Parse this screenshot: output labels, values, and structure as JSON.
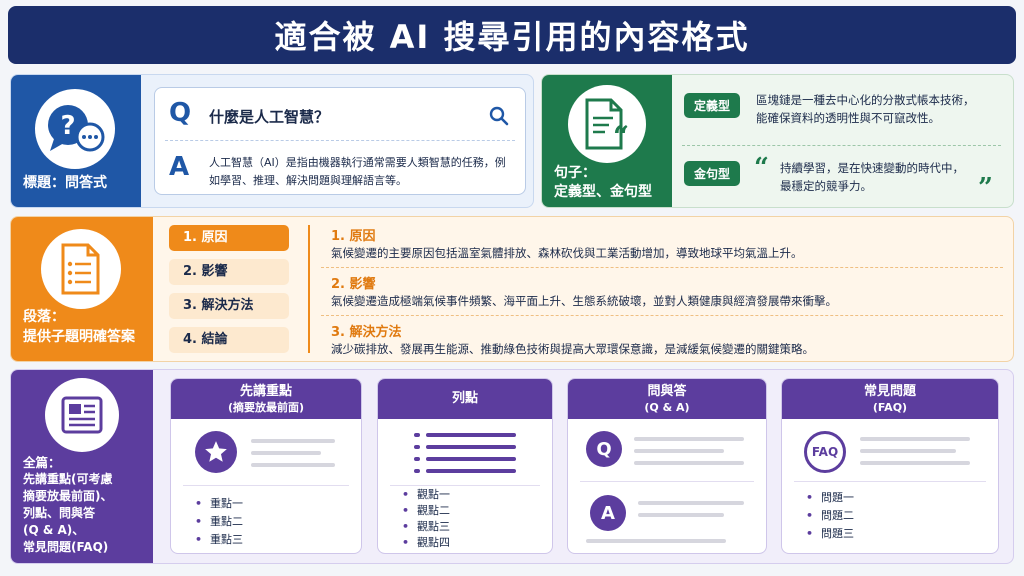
{
  "title": "適合被 AI 搜尋引用的內容格式",
  "qa_panel": {
    "label": "標題：問答式",
    "q_letter": "Q",
    "question": "什麼是人工智慧？",
    "a_letter": "A",
    "answer": "人工智慧（AI）是指由機器執行通常需要人類智慧的任務，例如學習、推理、解決問題與理解語言等。",
    "icon": "question-chat-icon"
  },
  "sentence_panel": {
    "label_line1": "句子：",
    "label_line2": "定義型、金句型",
    "definition_tag": "定義型",
    "definition_line1": "區塊鏈是一種去中心化的分散式帳本技術，",
    "definition_line2": "能確保資料的透明性與不可竄改性。",
    "quote_tag": "金句型",
    "quote_line1": "持續學習，是在快速變動的時代中，",
    "quote_line2": "最穩定的競爭力。",
    "icon": "document-quote-icon"
  },
  "paragraph_panel": {
    "label_line1": "段落：",
    "label_line2": "提供子題明確答案",
    "nav": [
      "1. 原因",
      "2. 影響",
      "3. 解決方法",
      "4. 結論"
    ],
    "sections": [
      {
        "heading": "1. 原因",
        "body": "氣候變遷的主要原因包括溫室氣體排放、森林砍伐與工業活動增加，導致地球平均氣溫上升。"
      },
      {
        "heading": "2. 影響",
        "body": "氣候變遷造成極端氣候事件頻繁、海平面上升、生態系統破壞，並對人類健康與經濟發展帶來衝擊。"
      },
      {
        "heading": "3. 解決方法",
        "body": "減少碳排放、發展再生能源、推動綠色技術與提高大眾環保意識，是減緩氣候變遷的關鍵策略。"
      }
    ],
    "icon": "list-document-icon"
  },
  "article_panel": {
    "label_lines": [
      "全篇：",
      "先講重點(可考慮",
      "摘要放最前面)、",
      "列點、問與答",
      "(Q & A)、",
      "常見問題(FAQ)"
    ],
    "icon": "newspaper-icon",
    "cards": [
      {
        "title": "先講重點",
        "subtitle": "(摘要放最前面)",
        "items": [
          "重點一",
          "重點二",
          "重點三"
        ],
        "icon": "star-icon"
      },
      {
        "title": "列點",
        "subtitle": "",
        "items": [
          "觀點一",
          "觀點二",
          "觀點三",
          "觀點四"
        ],
        "icon": "bullet-list-icon"
      },
      {
        "title": "問與答",
        "subtitle": "(Q & A)",
        "items": [],
        "q_badge": "Q",
        "a_badge": "A",
        "icon": "qa-bubble-icon"
      },
      {
        "title": "常見問題",
        "subtitle": "(FAQ)",
        "items": [
          "問題一",
          "問題二",
          "問題三"
        ],
        "faq_badge": "FAQ",
        "icon": "faq-icon"
      }
    ]
  },
  "colors": {
    "navy": "#1b2e6b",
    "blue": "#1f57a6",
    "green": "#1e7a4c",
    "orange": "#ef8a1a",
    "purple": "#5c3d9e"
  }
}
